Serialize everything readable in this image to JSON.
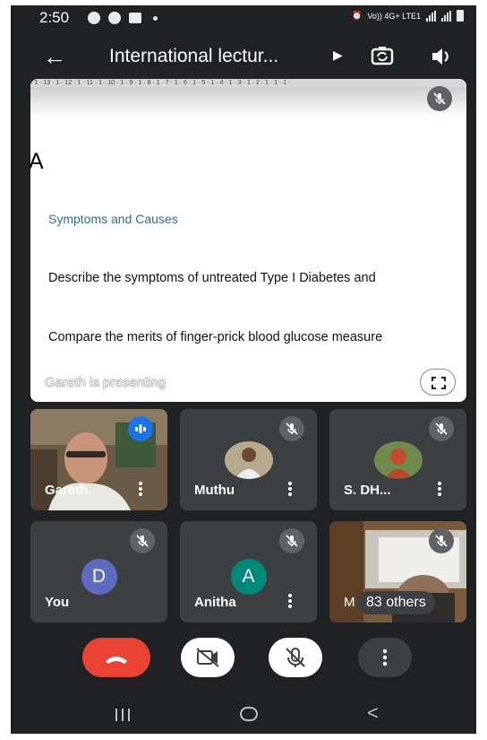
{
  "status_bar": {
    "time": "2:50",
    "network": "Vo)) 4G+ LTE1",
    "icons": [
      "chrome-icon",
      "chrome-icon",
      "gallery-icon",
      "dot-icon"
    ]
  },
  "header": {
    "title": "International lectur...",
    "back_icon": "arrow-left-icon",
    "chevron_icon": "triangle-right-icon",
    "switch_camera_icon": "switch-camera-icon",
    "audio_icon": "speaker-icon"
  },
  "presentation": {
    "ruler_text": "· 1 · 13 · 1 · 12 · 1 · 11 · 1 · 10 · 1 · 9 · 1 · 8 · 1 · 7 · 1 · 6 · 1 · 5 · 1 · 4 · 1 · 3 · 1 · 2 · 1 · 1 · 1 · ",
    "slide_letter": "A",
    "heading": "Symptoms and Causes",
    "line1": "Describe the symptoms of untreated Type I Diabetes and",
    "line2": "Compare the merits of finger-prick blood glucose measure",
    "caption": "Gareth is presenting"
  },
  "participants": [
    {
      "name": "Gareth",
      "type": "video",
      "speaking": true
    },
    {
      "name": "Muthu",
      "type": "photo",
      "muted": true
    },
    {
      "name": "S. DH...",
      "type": "photo",
      "muted": true
    },
    {
      "name": "You",
      "type": "initial",
      "initial": "D",
      "avatar_color": "#5c6bc0",
      "muted": true
    },
    {
      "name": "Anitha",
      "type": "initial",
      "initial": "A",
      "avatar_color": "#00897b",
      "muted": true
    },
    {
      "name": "M",
      "type": "video",
      "muted": true,
      "others_label": "83 others"
    }
  ],
  "controls": [
    "end-call-button",
    "camera-off-button",
    "mic-off-button",
    "more-options-button"
  ],
  "colors": {
    "background": "#202124",
    "tile": "#3c4043",
    "end_call": "#ea4335",
    "speaking": "#1a73e8"
  }
}
